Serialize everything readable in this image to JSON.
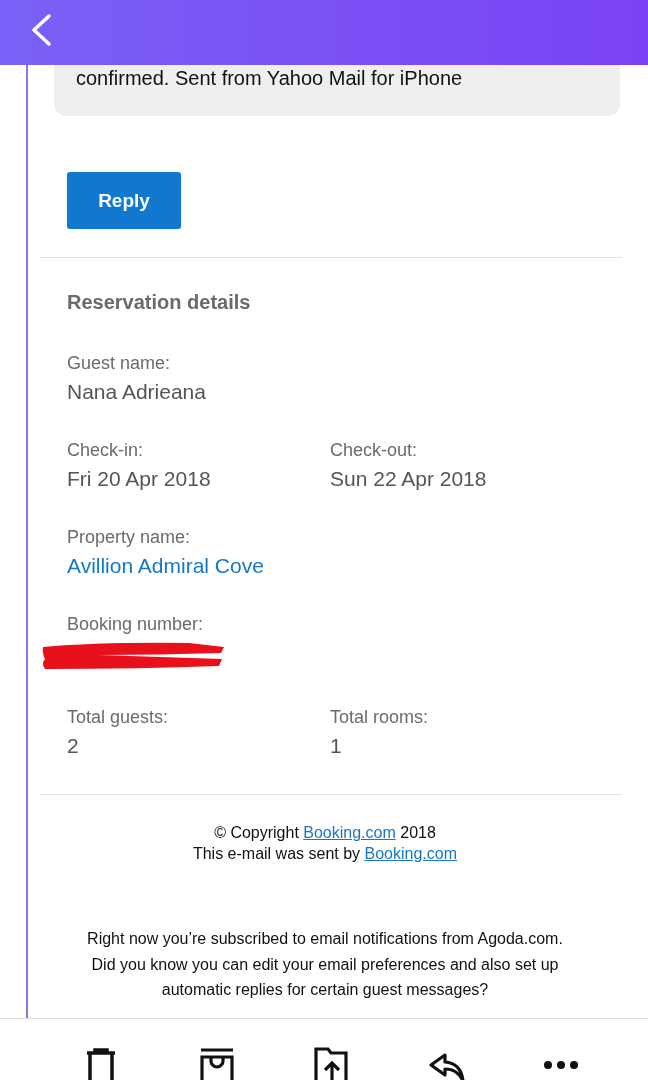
{
  "quoted_message": "confirmed. Sent from Yahoo Mail for iPhone",
  "reply_button": "Reply",
  "reservation": {
    "title": "Reservation details",
    "rows": [
      [
        {
          "label": "Guest name:",
          "value": "Nana Adrieana",
          "kind": "text"
        }
      ],
      [
        {
          "label": "Check-in:",
          "value": "Fri 20 Apr 2018",
          "kind": "text"
        },
        {
          "label": "Check-out:",
          "value": "Sun 22 Apr 2018",
          "kind": "text"
        }
      ],
      [
        {
          "label": "Property name:",
          "value": "Avillion Admiral Cove",
          "kind": "link"
        }
      ],
      [
        {
          "label": "Booking number:",
          "kind": "redacted"
        }
      ],
      [
        {
          "label": "Total guests:",
          "value": "2",
          "kind": "text"
        },
        {
          "label": "Total rooms:",
          "value": "1",
          "kind": "text"
        }
      ]
    ]
  },
  "footer": [
    {
      "before": "© Copyright ",
      "link": "Booking.com",
      "after": " 2018"
    },
    {
      "before": "This e-mail was sent by ",
      "link": "Booking.com"
    }
  ],
  "notice": "Right now you’re subscribed to email notifications from Agoda.com. Did you know you can edit your email preferences and also set up automatic replies for certain guest messages?",
  "toolbar": [
    {
      "kind": "delete"
    },
    {
      "kind": "archive"
    },
    {
      "kind": "move"
    },
    {
      "kind": "reply"
    },
    {
      "kind": "more"
    }
  ]
}
